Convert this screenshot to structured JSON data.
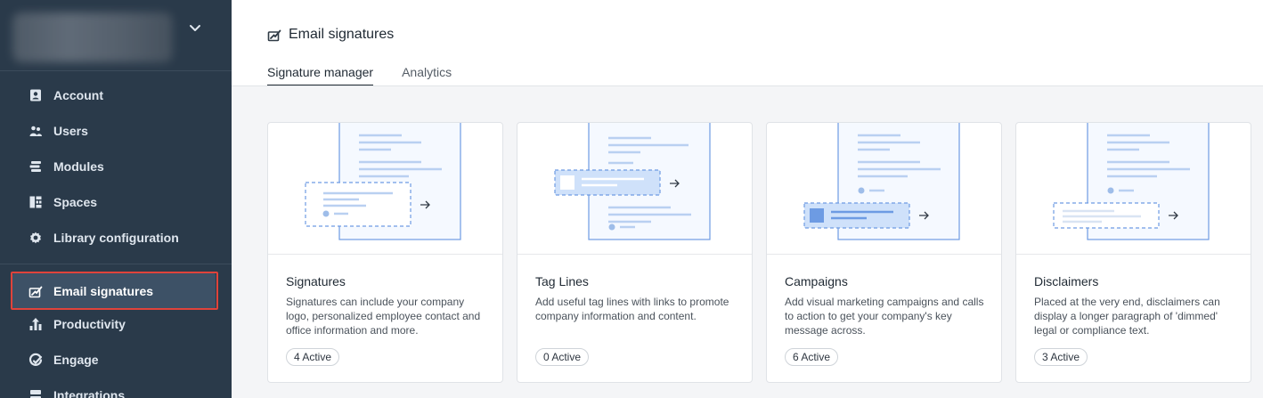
{
  "sidebar": {
    "items": [
      {
        "label": "Account",
        "icon": "account-icon"
      },
      {
        "label": "Users",
        "icon": "users-icon"
      },
      {
        "label": "Modules",
        "icon": "modules-icon"
      },
      {
        "label": "Spaces",
        "icon": "spaces-icon"
      },
      {
        "label": "Library configuration",
        "icon": "gear-icon"
      },
      {
        "label": "Email signatures",
        "icon": "signature-icon",
        "active": true
      },
      {
        "label": "Productivity",
        "icon": "productivity-icon"
      },
      {
        "label": "Engage",
        "icon": "engage-icon"
      },
      {
        "label": "Integrations",
        "icon": "integrations-icon"
      }
    ]
  },
  "header": {
    "title": "Email signatures",
    "icon": "signature-icon"
  },
  "tabs": [
    {
      "label": "Signature manager",
      "active": true
    },
    {
      "label": "Analytics",
      "active": false
    }
  ],
  "cards": [
    {
      "title": "Signatures",
      "description": "Signatures can include your company logo, personalized employee contact and office information and more.",
      "badge": "4 Active"
    },
    {
      "title": "Tag Lines",
      "description": "Add useful tag lines with links to promote company information and content.",
      "badge": "0 Active"
    },
    {
      "title": "Campaigns",
      "description": "Add visual marketing campaigns and calls to action to get your company's key message across.",
      "badge": "6 Active"
    },
    {
      "title": "Disclaimers",
      "description": "Placed at the very end, disclaimers can display a longer paragraph of 'dimmed' legal or compliance text.",
      "badge": "3 Active"
    }
  ],
  "colors": {
    "sidebar_bg": "#2a3a4a",
    "active_bg": "#3d5166",
    "highlight": "#e0433b",
    "illustration_blue": "#6d9be3"
  }
}
